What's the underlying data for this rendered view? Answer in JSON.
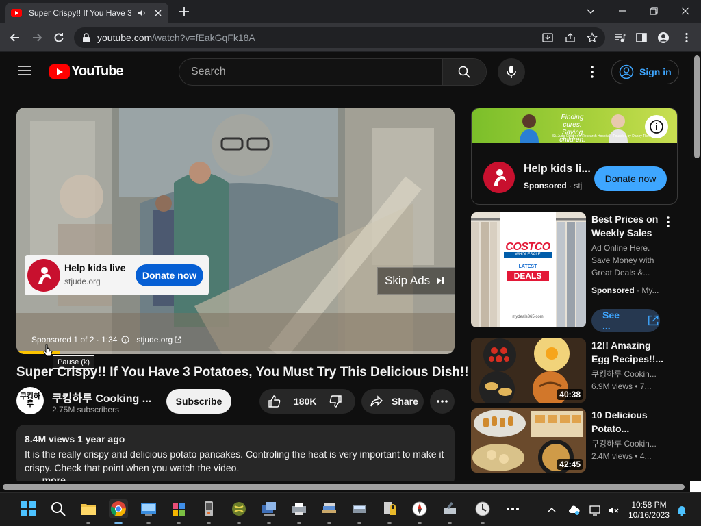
{
  "browser": {
    "tab_title": "Super Crispy!! If You Have 3",
    "url_domain": "youtube.com",
    "url_path": "/watch?v=fEakGqFk18A"
  },
  "youtube": {
    "logo_text": "YouTube",
    "search_placeholder": "Search",
    "signin_label": "Sign in"
  },
  "player": {
    "ad_card": {
      "headline": "Help kids live",
      "domain": "stjude.org",
      "cta": "Donate now"
    },
    "skip_label": "Skip Ads",
    "sponsored_text": "Sponsored 1 of 2 · 1:34",
    "sponsored_link": "stjude.org",
    "progress": 0.1,
    "tooltip": "Pause (k)"
  },
  "video": {
    "title": "Super Crispy!! If You Have 3 Potatoes, You Must Try This Delicious Dish!!",
    "channel_avatar_text": "쿠킹하루",
    "channel_name": "쿠킹하루 Cooking ...",
    "subscribers": "2.75M subscribers",
    "subscribe_label": "Subscribe",
    "likes": "180K",
    "share_label": "Share",
    "stats": "8.4M views  1 year ago",
    "description": "It is the really crispy and delicious potato pancakes. Controling the heat is very important to make it crispy. Check that point when you watch the video.",
    "more_label": "...more"
  },
  "sidebar": {
    "banner": {
      "tagline": "Finding cures. Saving children.",
      "fine_print": "St. Jude Children's Research Hospital · Founded by Danny Thomas",
      "headline": "Help kids li...",
      "sponsored": "Sponsored",
      "domain": "· stj",
      "cta": "Donate now"
    },
    "ad2": {
      "thumb_brand": "COSTCO",
      "thumb_brand_sub": "WHOLESALE",
      "thumb_badge_top": "LATEST",
      "thumb_badge_main": "DEALS",
      "thumb_site": "mydeals365.com",
      "title": "Best Prices on Weekly Sales",
      "body": "Ad Online Here. Save Money with Great Deals &...",
      "sponsored": "Sponsored",
      "advertiser": "· My...",
      "cta": "See ..."
    },
    "videos": [
      {
        "title": "12!! Amazing Egg Recipes!!...",
        "channel": "쿠킹하루 Cookin...",
        "meta": "6.9M views  • 7...",
        "duration": "40:38"
      },
      {
        "title": "10 Delicious Potato...",
        "channel": "쿠킹하루 Cookin...",
        "meta": "2.4M views  • 4...",
        "duration": "42:45"
      }
    ]
  },
  "taskbar": {
    "time": "10:58 PM",
    "date": "10/16/2023"
  }
}
